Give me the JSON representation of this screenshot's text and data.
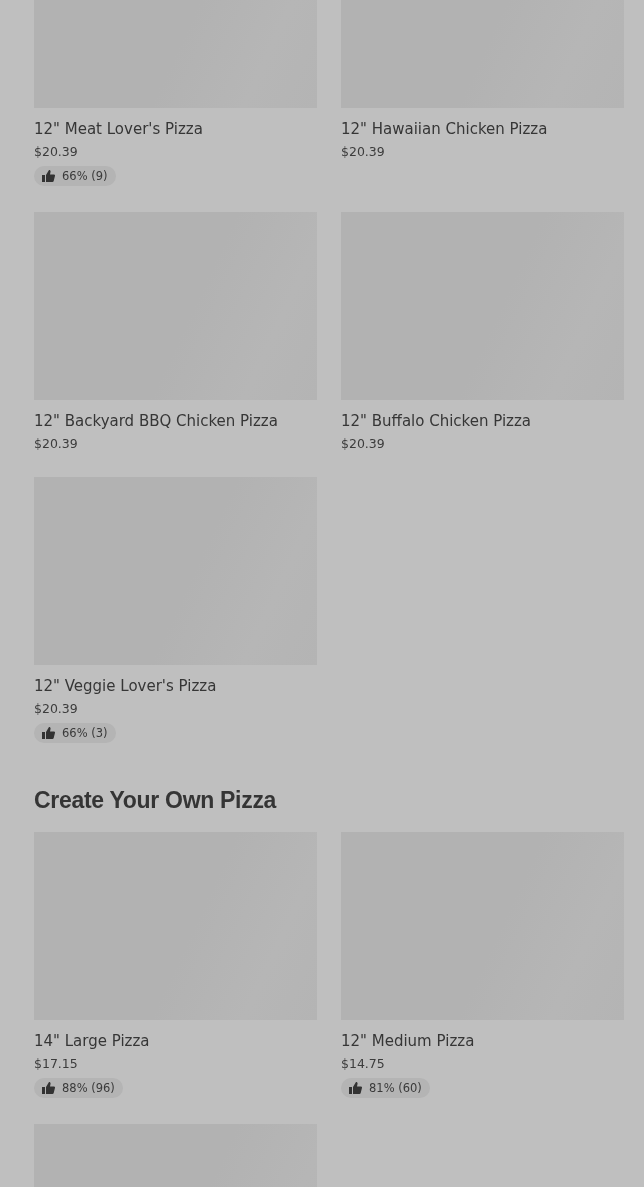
{
  "sections": [
    {
      "items": [
        {
          "kind": "product",
          "name": "12\" Meat Lover's Pizza",
          "price": "$20.39",
          "rating": "66% (9)"
        },
        {
          "kind": "product",
          "name": "12\" Hawaiian Chicken Pizza",
          "price": "$20.39"
        },
        {
          "kind": "product",
          "name": "12\" Backyard BBQ Chicken Pizza",
          "price": "$20.39"
        },
        {
          "kind": "product",
          "name": "12\" Buffalo Chicken Pizza",
          "price": "$20.39"
        },
        {
          "kind": "product",
          "name": "12\" Veggie Lover's Pizza",
          "price": "$20.39",
          "rating": "66% (3)"
        }
      ]
    },
    {
      "title": "Create Your Own Pizza",
      "items": [
        {
          "kind": "product",
          "name": "14\" Large Pizza",
          "price": "$17.15",
          "rating": "88% (96)"
        },
        {
          "kind": "product",
          "name": "12\" Medium Pizza",
          "price": "$14.75",
          "rating": "81% (60)"
        },
        {
          "kind": "image_only"
        }
      ]
    }
  ]
}
